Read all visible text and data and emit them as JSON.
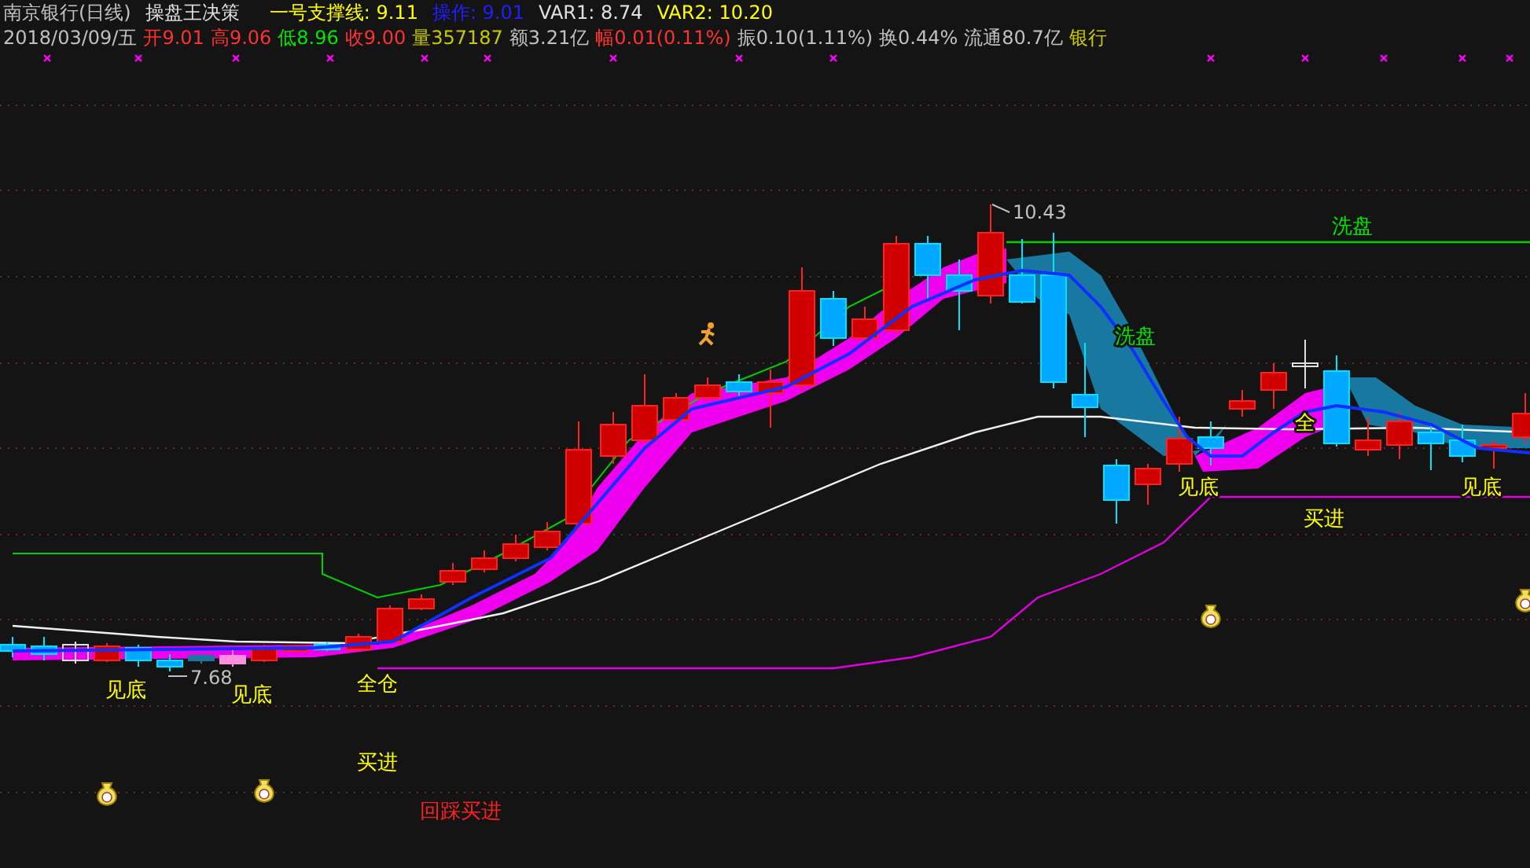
{
  "header": {
    "title": "南京银行(日线)",
    "formula": "操盘王决策",
    "indicators": [
      {
        "label": "一号支撑线:",
        "value": "9.11",
        "color": "#ffff00"
      },
      {
        "label": "操作:",
        "value": "9.01",
        "color": "#2020ff"
      },
      {
        "label": "VAR1:",
        "value": "8.74",
        "color": "#e0e0e0"
      },
      {
        "label": "VAR2:",
        "value": "10.20",
        "color": "#ffff00"
      }
    ]
  },
  "quote": {
    "date": "2018/03/09/五",
    "items": [
      {
        "label": "开",
        "value": "9.01",
        "color": "#ff3232"
      },
      {
        "label": "高",
        "value": "9.06",
        "color": "#ff3232"
      },
      {
        "label": "低",
        "value": "8.96",
        "color": "#00e600"
      },
      {
        "label": "收",
        "value": "9.00",
        "color": "#ff3232"
      },
      {
        "label": "量",
        "value": "357187",
        "color": "#c8c800"
      },
      {
        "label": "额",
        "value": "3.21亿",
        "color": "#c0c0c0"
      },
      {
        "label": "幅",
        "value": "0.01(0.11%)",
        "color": "#ff3232"
      },
      {
        "label": "振",
        "value": "0.10(1.11%)",
        "color": "#c0c0c0"
      },
      {
        "label": "换",
        "value": "0.44%",
        "color": "#c0c0c0"
      },
      {
        "label": "流通",
        "value": "80.7亿",
        "color": "#c0c0c0"
      }
    ],
    "sector": "银行"
  },
  "chart": {
    "price_labels": [
      "10.43",
      "7.68"
    ],
    "signals": [
      {
        "text": "洗盘",
        "color": "#00e600"
      },
      {
        "text": "洗盘",
        "color": "#00e600"
      },
      {
        "text": "见底",
        "color": "#ffff00"
      },
      {
        "text": "见底",
        "color": "#ffff00"
      },
      {
        "text": "全仓",
        "color": "#ffff00"
      },
      {
        "text": "全",
        "color": "#ffff00"
      },
      {
        "text": "见底",
        "color": "#ffff00"
      },
      {
        "text": "买进",
        "color": "#ffff00"
      },
      {
        "text": "见底",
        "color": "#ffff00"
      },
      {
        "text": "买进",
        "color": "#ffff00"
      },
      {
        "text": "回踩买进",
        "color": "#ff2020"
      }
    ]
  }
}
